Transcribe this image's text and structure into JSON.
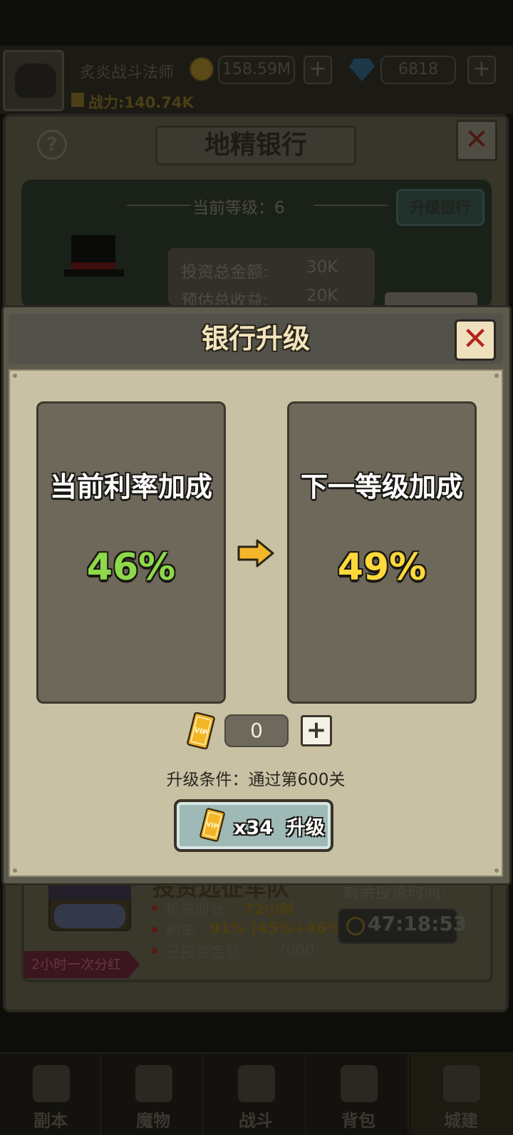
{
  "player": {
    "name": "炙炎战斗法师",
    "gold": "158.59M",
    "diamonds": "6818",
    "power_label": "战力",
    "power_value": "140.74K"
  },
  "bank": {
    "title": "地精银行",
    "current_level_label": "当前等级：6",
    "upgrade_bank_label": "升级银行",
    "total_investment_label": "投资总金额:",
    "total_investment_value": "30K",
    "estimated_income_label": "预估总收益:",
    "estimated_income_value": "20K"
  },
  "investment": {
    "title": "投资远征军队",
    "duration_label": "投资时长",
    "duration_value": "72小时",
    "rate_label": "利率",
    "rate_value": "91% (45%+46%)",
    "invested_label": "已投资金额:",
    "invested_value": "7000",
    "remaining_label": "剩余投资时间:",
    "remaining_time": "47:18:53",
    "dividend_tag": "2小时一次分红"
  },
  "dialog": {
    "title": "银行升级",
    "current": {
      "label": "当前利率加成",
      "value": "46%",
      "value_color": "#8ed94a"
    },
    "next": {
      "label": "下一等级加成",
      "value": "49%",
      "value_color": "#ffd93b"
    },
    "vip_quantity": "0",
    "condition": "升级条件：通过第600关",
    "upgrade_button": {
      "cost": "x34",
      "label": "升级"
    }
  },
  "nav": [
    {
      "label": "副本",
      "icon": "dungeon-icon"
    },
    {
      "label": "魔物",
      "icon": "monster-icon"
    },
    {
      "label": "战斗",
      "icon": "battle-icon"
    },
    {
      "label": "背包",
      "icon": "backpack-icon"
    },
    {
      "label": "城建",
      "icon": "castle-icon"
    }
  ],
  "colors": {
    "accent_gold": "#f2b628",
    "dialog_bg": "#c8c1a3",
    "button_teal": "#9fbab6"
  }
}
